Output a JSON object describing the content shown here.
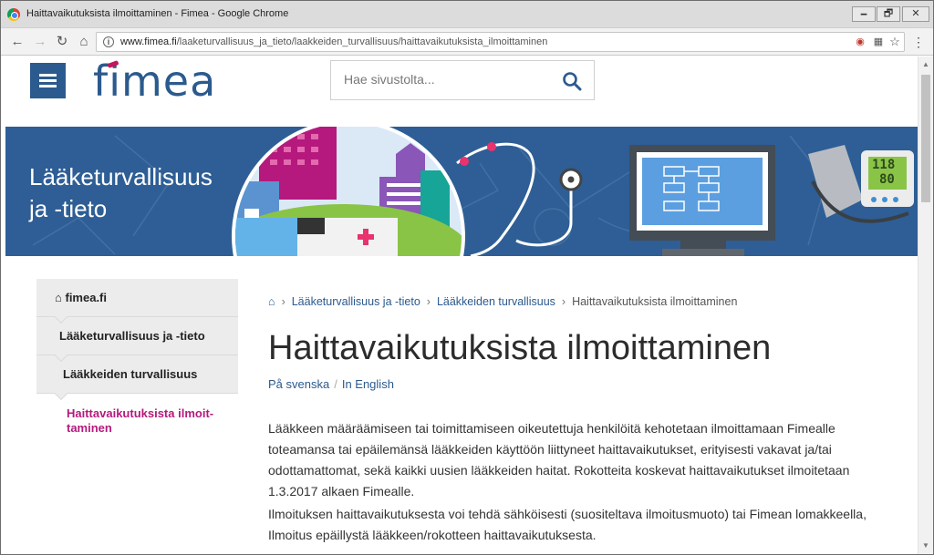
{
  "browser": {
    "title": "Haittavaikutuksista ilmoittaminen - Fimea - Google Chrome",
    "url_host": "www.fimea.fi",
    "url_path": "/laaketurvallisuus_ja_tieto/laakkeiden_turvallisuus/haittavaikutuksista_ilmoittaminen",
    "minimize": "🗕",
    "maximize": "🗗",
    "close": "✕"
  },
  "header": {
    "logo_text": "fimea",
    "search_placeholder": "Hae sivustolta..."
  },
  "banner": {
    "title_line1": "Lääketurvallisuus",
    "title_line2": "ja -tieto",
    "monitor_reading_1": "118",
    "monitor_reading_2": "80"
  },
  "sidenav": {
    "home": "fimea.fi",
    "item1": "Lääketurvallisuus ja -tieto",
    "item2": "Lääkkeiden turvallisuus",
    "active_line1": "Haittavaikutuksista ilmoit-",
    "active_line2": "taminen"
  },
  "breadcrumb": {
    "level1": "Lääketurvallisuus ja -tieto",
    "level2": "Lääkkeiden turvallisuus",
    "current": "Haittavaikutuksista ilmoittaminen"
  },
  "main": {
    "title": "Haittavaikutuksista ilmoittaminen",
    "lang_sv": "På svenska",
    "lang_en": "In English",
    "lang_sep": "/",
    "paragraph1": "Lääkkeen määräämiseen tai toimittamiseen oikeutettuja henkilöitä kehotetaan ilmoittamaan Fimealle toteamansa tai epäilemänsä lääkkeiden käyttöön liittyneet haittavaikutukset, erityisesti vakavat ja/tai odottamattomat, sekä kaikki uusien lääkkeiden haitat. Rokotteita koskevat haittavaikutukset ilmoitetaan 1.3.2017 alkaen Fimealle.",
    "paragraph2": "Ilmoituksen haittavaikutuksesta voi tehdä sähköisesti (suositeltava ilmoitusmuoto) tai Fimean lomakkeella, Ilmoitus epäillystä lääkkeen/rokotteen haittavaikutuksesta."
  },
  "colors": {
    "brand_blue": "#2b5a8e",
    "accent_magenta": "#b5197d",
    "banner_blue": "#2e5e95"
  }
}
